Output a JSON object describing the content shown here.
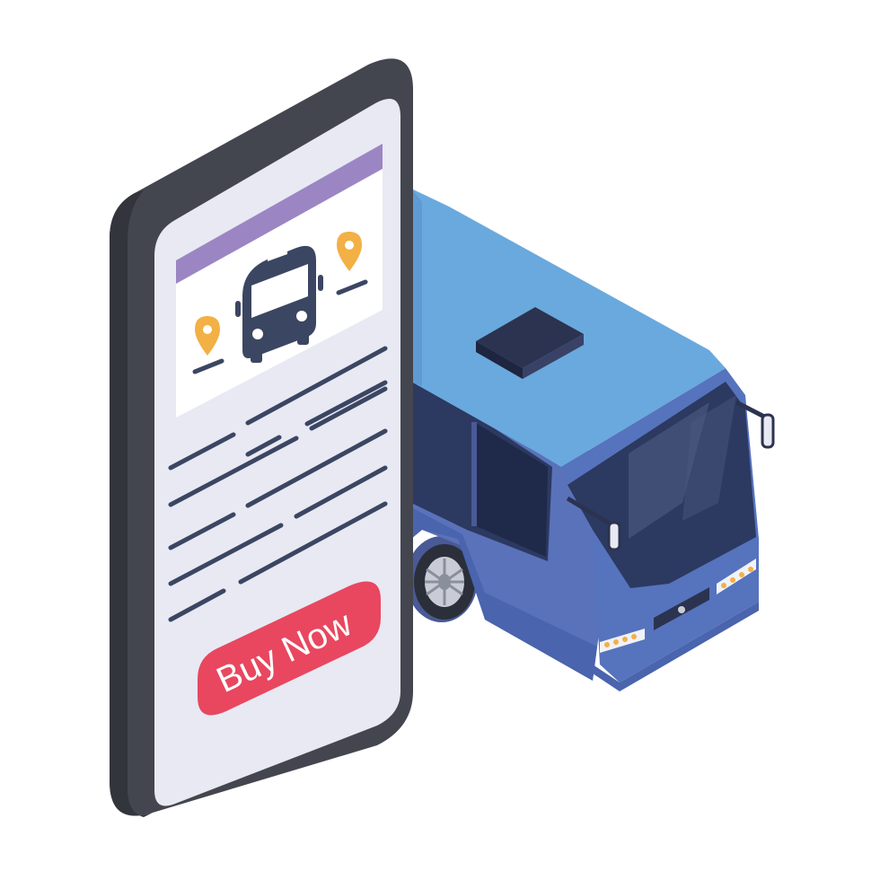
{
  "button": {
    "label": "Buy Now"
  },
  "icons": [
    "smartphone-icon",
    "bus-icon",
    "location-pin-icon",
    "ticket-card-icon"
  ],
  "colors": {
    "phone_frame": "#44464f",
    "phone_screen": "#e8e9f3",
    "header_bar": "#9b86c3",
    "buy_button": "#e8475f",
    "bus_roof": "#6aa9dd",
    "bus_body": "#5673bd",
    "bus_dark": "#2c3960",
    "pin": "#f2b045"
  }
}
